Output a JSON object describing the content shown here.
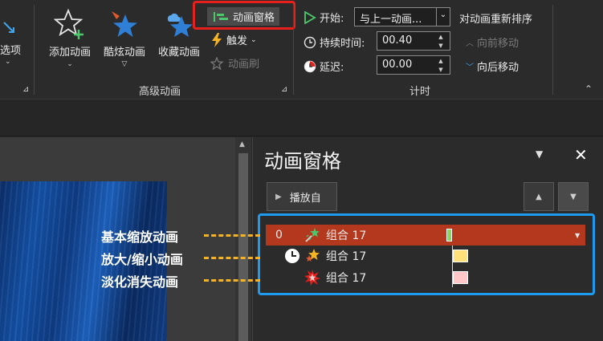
{
  "ribbon": {
    "partial_left_label": "选项",
    "advanced_group": {
      "label": "高级动画",
      "add_animation": "添加动画",
      "cool_animation": "酷炫动画",
      "favorite_animation": "收藏动画",
      "animation_pane": "动画窗格",
      "trigger": "触发",
      "animation_painter": "动画刷"
    },
    "timing_group": {
      "label": "计时",
      "start_label": "开始:",
      "start_value": "与上一动画...",
      "duration_label": "持续时间:",
      "duration_value": "00.40",
      "delay_label": "延迟:",
      "delay_value": "00.00",
      "reorder_label": "对动画重新排序",
      "move_earlier": "向前移动",
      "move_later": "向后移动"
    }
  },
  "pane": {
    "title": "动画窗格",
    "play_from": "播放自",
    "items": [
      {
        "index": "0",
        "name": "组合 17",
        "bar_color": "#8dd35f",
        "selected": true
      },
      {
        "index": "",
        "name": "组合 17",
        "bar_color": "#ffe07a",
        "selected": false
      },
      {
        "index": "",
        "name": "组合 17",
        "bar_color": "#ffc7c7",
        "selected": false
      }
    ]
  },
  "annotations": {
    "basic_zoom": "基本缩放动画",
    "zoom_in_out": "放大/缩小动画",
    "fade_out": "淡化消失动画"
  },
  "colors": {
    "highlight_red": "#e8201b",
    "annotation_blue": "#1e9bf0",
    "annotation_orange": "#f5b324",
    "selected_row": "#b3381d"
  }
}
